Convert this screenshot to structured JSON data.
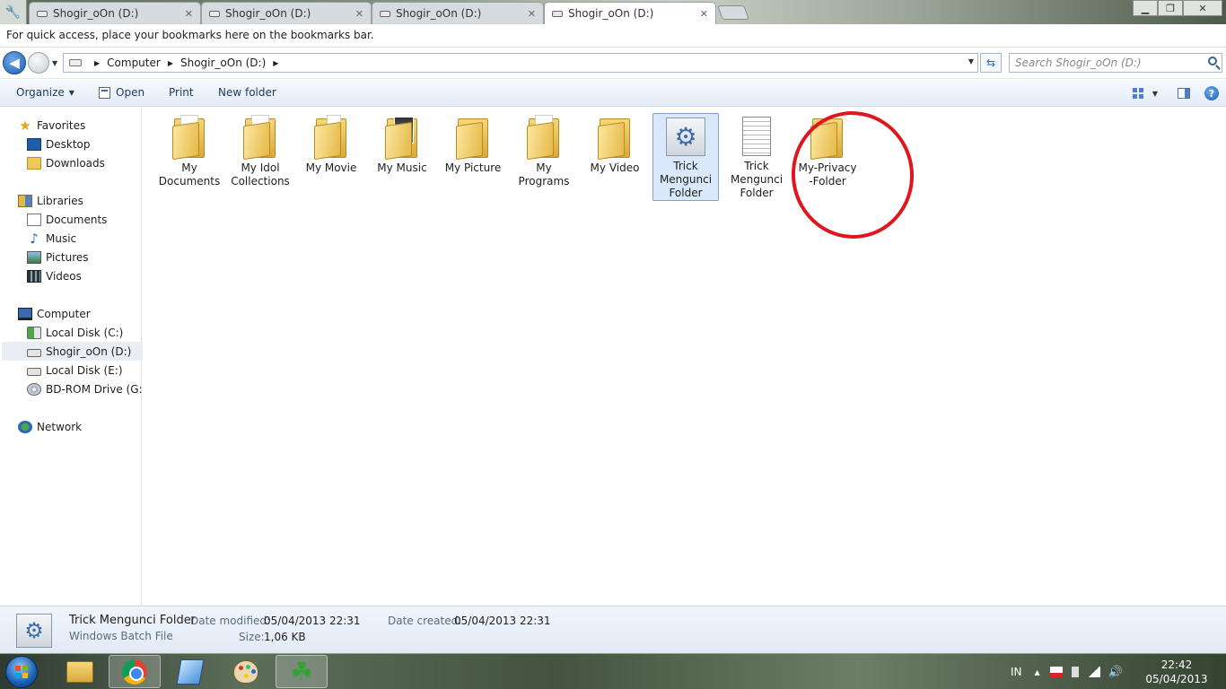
{
  "browser": {
    "tabs": [
      {
        "label": "Shogir_oOn (D:)",
        "active": false
      },
      {
        "label": "Shogir_oOn (D:)",
        "active": false
      },
      {
        "label": "Shogir_oOn (D:)",
        "active": false
      },
      {
        "label": "Shogir_oOn (D:)",
        "active": true
      }
    ],
    "bookmarks_hint": "For quick access, place your bookmarks here on the bookmarks bar."
  },
  "address": {
    "crumbs": [
      "Computer",
      "Shogir_oOn (D:)"
    ],
    "search_placeholder": "Search Shogir_oOn (D:)"
  },
  "toolbar": {
    "organize": "Organize",
    "open": "Open",
    "print": "Print",
    "new_folder": "New folder"
  },
  "nav": {
    "favorites": "Favorites",
    "desktop": "Desktop",
    "downloads": "Downloads",
    "libraries": "Libraries",
    "documents": "Documents",
    "music": "Music",
    "pictures": "Pictures",
    "videos": "Videos",
    "computer": "Computer",
    "local_c": "Local Disk (C:)",
    "drive_d": "Shogir_oOn (D:)",
    "local_e": "Local Disk (E:)",
    "bd_rom": "BD-ROM Drive (G:) C",
    "network": "Network"
  },
  "files": [
    {
      "line1": "My",
      "line2": "Documents",
      "line3": ""
    },
    {
      "line1": "My Idol",
      "line2": "Collections",
      "line3": ""
    },
    {
      "line1": "My Movie",
      "line2": "",
      "line3": ""
    },
    {
      "line1": "My Music",
      "line2": "",
      "line3": ""
    },
    {
      "line1": "My Picture",
      "line2": "",
      "line3": ""
    },
    {
      "line1": "My",
      "line2": "Programs",
      "line3": ""
    },
    {
      "line1": "My Video",
      "line2": "",
      "line3": ""
    },
    {
      "line1": "Trick",
      "line2": "Mengunci",
      "line3": "Folder"
    },
    {
      "line1": "Trick",
      "line2": "Mengunci",
      "line3": "Folder"
    },
    {
      "line1": "My-Privacy",
      "line2": "-Folder",
      "line3": ""
    }
  ],
  "details": {
    "name": "Trick Mengunci Folder",
    "type": "Windows Batch File",
    "date_modified_label": "Date modified:",
    "date_modified": "05/04/2013 22:31",
    "date_created_label": "Date created:",
    "date_created": "05/04/2013 22:31",
    "size_label": "Size:",
    "size": "1,06 KB"
  },
  "taskbar": {
    "lang": "IN",
    "time": "22:42",
    "date": "05/04/2013"
  }
}
